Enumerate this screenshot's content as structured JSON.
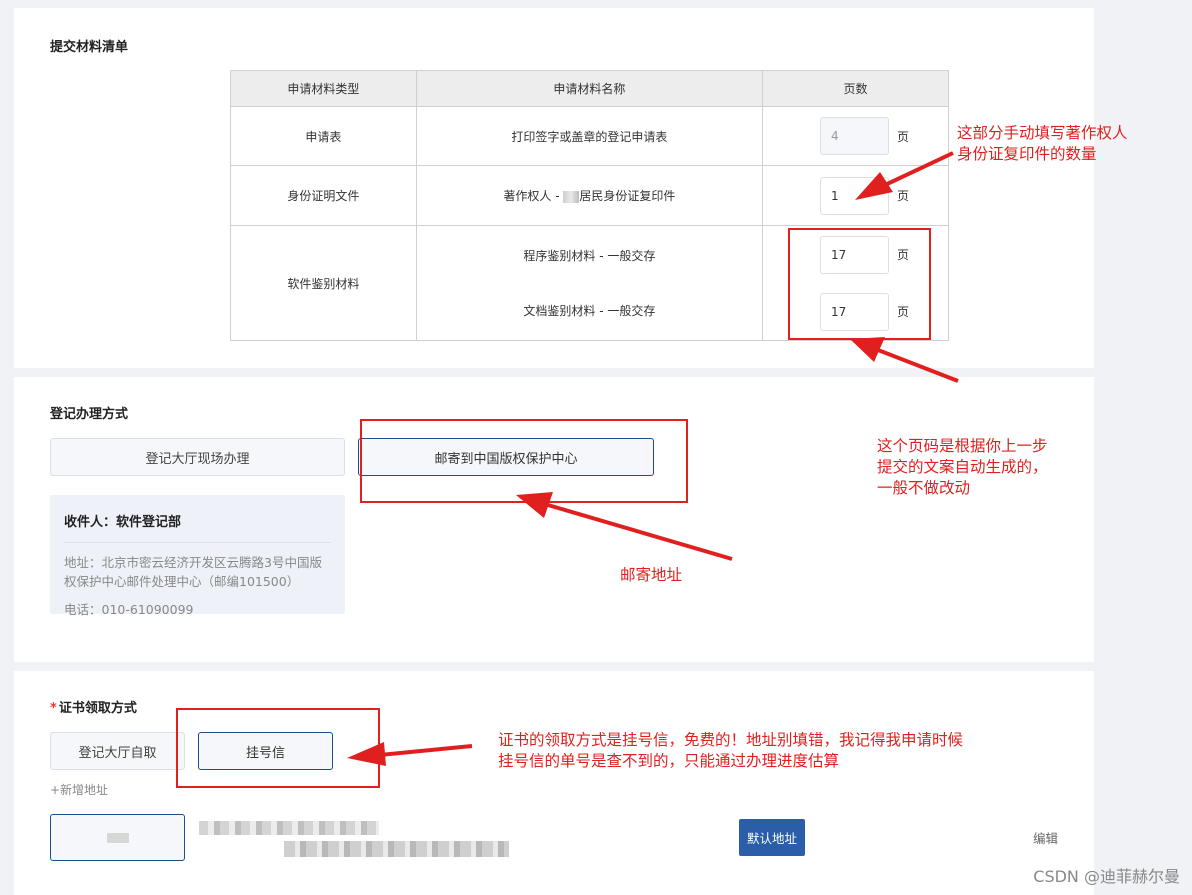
{
  "materials": {
    "title": "提交材料清单",
    "headers": [
      "申请材料类型",
      "申请材料名称",
      "页数"
    ],
    "page_unit": "页",
    "rows": [
      {
        "type": "申请表",
        "name": "打印签字或盖章的登记申请表",
        "pages": "4"
      },
      {
        "type": "身份证明文件",
        "name_prefix": "著作权人 - ",
        "name_suffix": "居民身份证复印件",
        "pages": "1"
      },
      {
        "type": "软件鉴别材料",
        "items": [
          {
            "name": "程序鉴别材料 - 一般交存",
            "pages": "17"
          },
          {
            "name": "文档鉴别材料 - 一般交存",
            "pages": "17"
          }
        ]
      }
    ]
  },
  "handling": {
    "title": "登记办理方式",
    "options": [
      "登记大厅现场办理",
      "邮寄到中国版权保护中心"
    ],
    "selected": "邮寄到中国版权保护中心",
    "recipient": "收件人：软件登记部",
    "address": "地址：北京市密云经济开发区云腾路3号中国版权保护中心邮件处理中心（邮编101500）",
    "phone": "电话：010-61090099"
  },
  "certificate": {
    "title": "证书领取方式",
    "options": [
      "登记大厅自取",
      "挂号信"
    ],
    "selected": "挂号信",
    "add_address": "+新增地址",
    "default_address": "默认地址",
    "edit": "编辑"
  },
  "annotations": {
    "id_copies": [
      "这部分手动填写著作权人",
      "身份证复印件的数量"
    ],
    "page_auto": [
      "这个页码是根据你上一步",
      "提交的文案自动生成的，",
      "一般不做改动"
    ],
    "mail_address": "邮寄地址",
    "certificate_note": [
      "证书的领取方式是挂号信，免费的！地址别填错，我记得我申请时候",
      "挂号信的单号是查不到的，只能通过办理进度估算"
    ],
    "color": "#e0201f"
  },
  "watermark": "CSDN @迪菲赫尔曼"
}
